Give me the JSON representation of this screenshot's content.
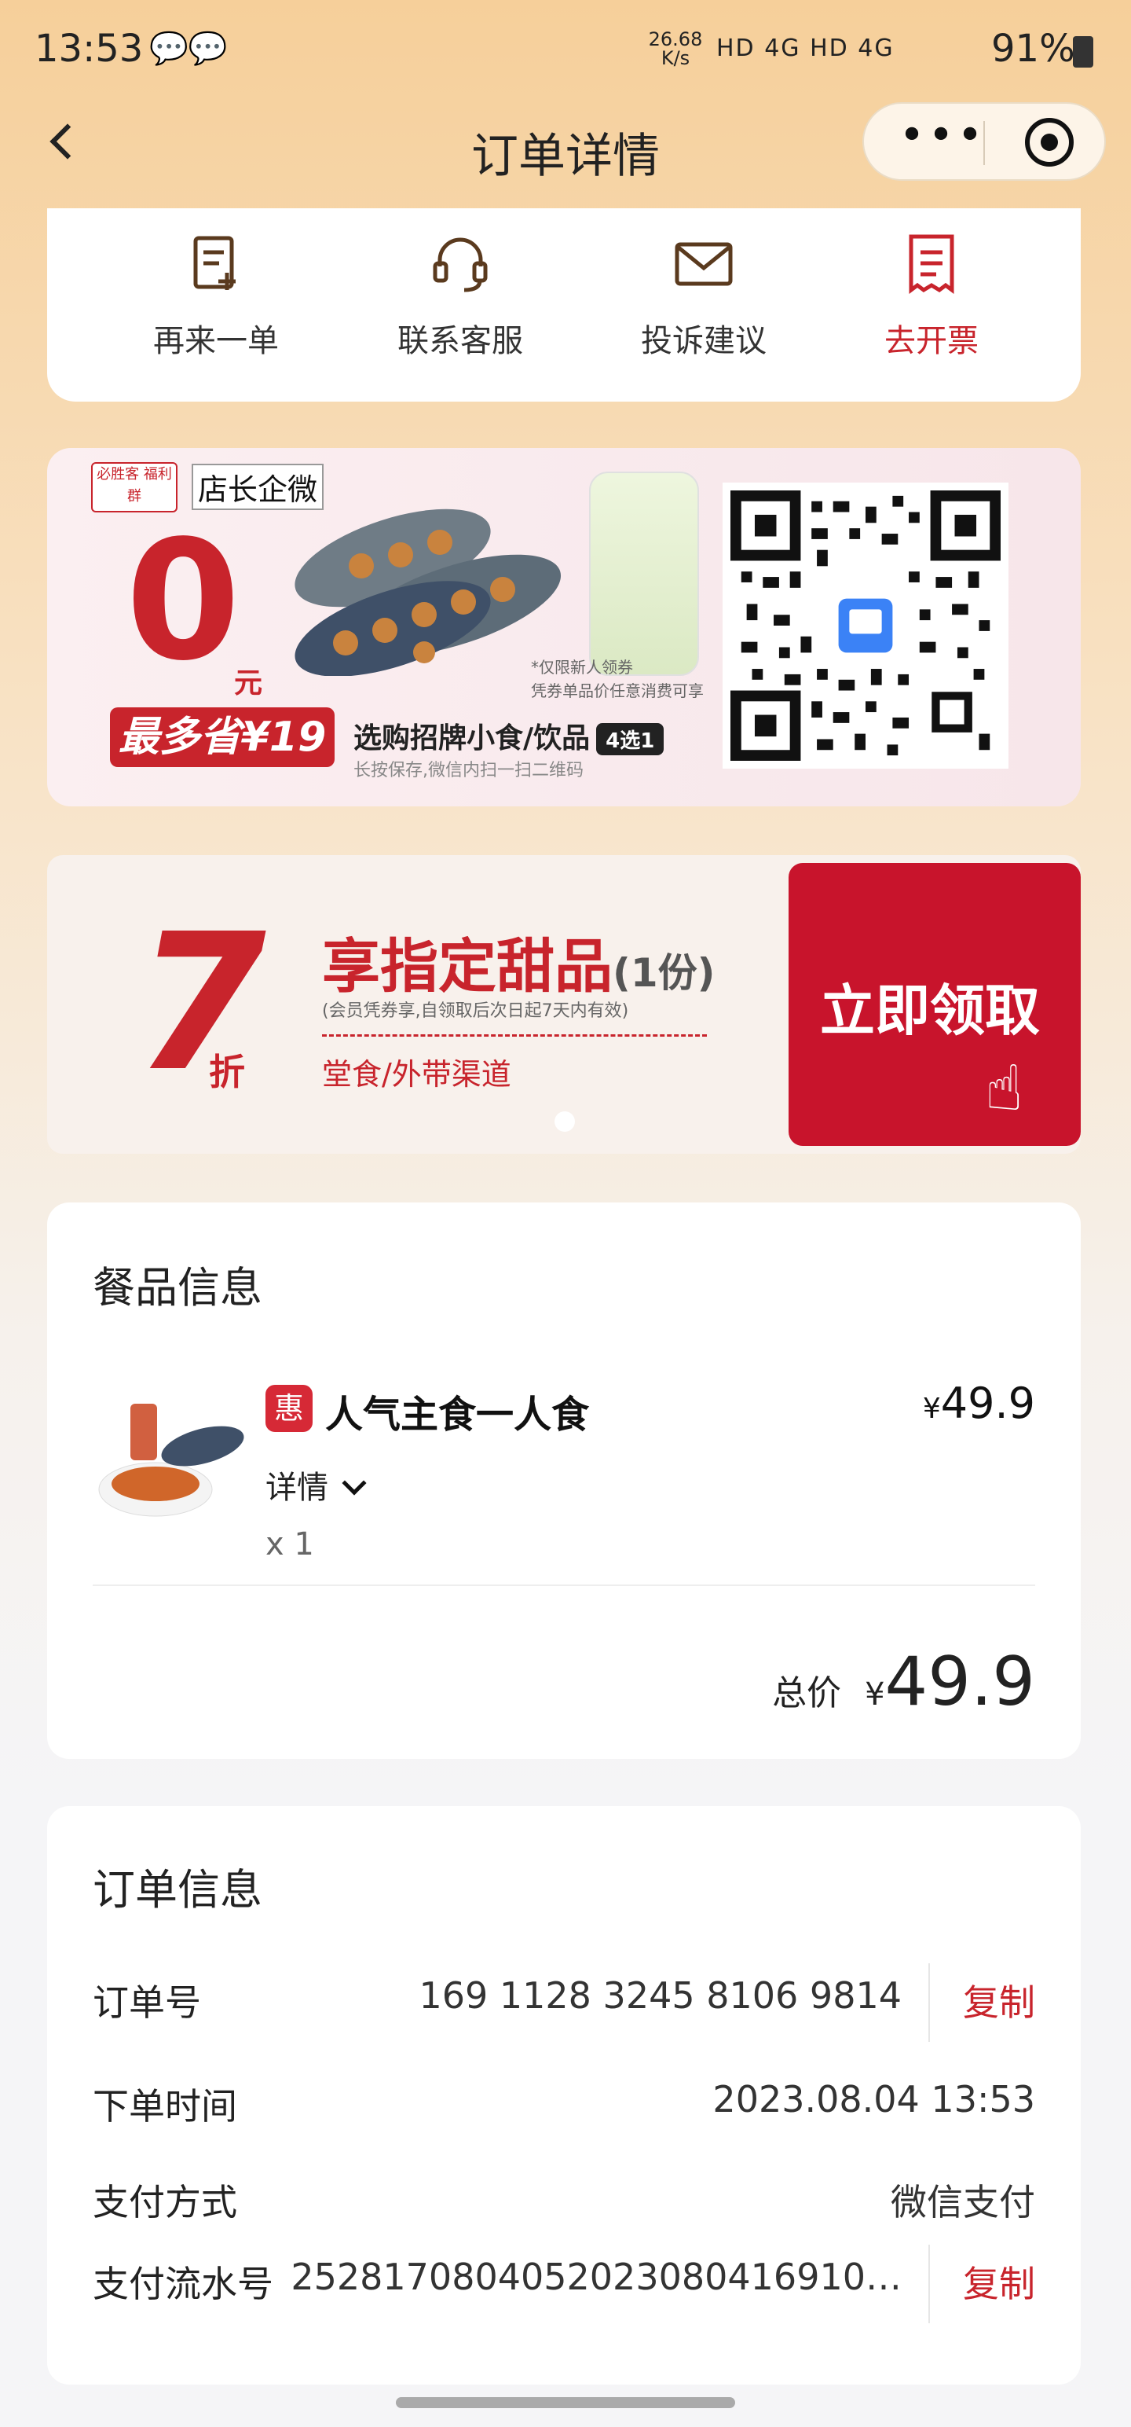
{
  "status_bar": {
    "time": "13:53",
    "net_speed": "26.68",
    "net_unit": "K/s",
    "signal_text": "HD 4G HD 4G",
    "battery": "91%"
  },
  "nav": {
    "title": "订单详情"
  },
  "actions": [
    {
      "label": "再来一单",
      "icon": "reorder-icon"
    },
    {
      "label": "联系客服",
      "icon": "headset-icon"
    },
    {
      "label": "投诉建议",
      "icon": "mail-icon"
    },
    {
      "label": "去开票",
      "icon": "invoice-icon"
    }
  ],
  "promo1": {
    "logo_text": "必胜客 福利群",
    "tag": "店长企微",
    "big_number": "0",
    "unit": "元",
    "save_badge": "最多省¥19",
    "main_text": "选购招牌小食/饮品",
    "pill": "4选1",
    "sub_text": "长按保存,微信内扫一扫二维码",
    "note_line1": "*仅限新人领券",
    "note_line2": "凭券单品价任意消费可享"
  },
  "promo2": {
    "discount": "7",
    "discount_unit": "折",
    "title": "享指定甜品",
    "title_suffix": "(1份)",
    "note": "(会员凭券享,自领取后次日起7天内有效)",
    "channel": "堂食/外带渠道",
    "button": "立即领取"
  },
  "food": {
    "section_title": "餐品信息",
    "badge": "惠",
    "name": "人气主食一人食",
    "currency": "¥",
    "price": "49.9",
    "detail_label": "详情",
    "quantity": "x 1",
    "total_label": "总价",
    "total_value": "49.9"
  },
  "order": {
    "section_title": "订单信息",
    "rows": [
      {
        "key": "订单号",
        "value": "169 1128 3245 8106 9814",
        "action": "复制"
      },
      {
        "key": "下单时间",
        "value": "2023.08.04 13:53"
      },
      {
        "key": "支付方式",
        "value": "微信支付"
      },
      {
        "key": "支付流水号",
        "value": "2528170804052023080416910…",
        "action": "复制"
      }
    ]
  },
  "colors": {
    "accent_red": "#c8242c",
    "background_top": "#f6cf9a"
  }
}
